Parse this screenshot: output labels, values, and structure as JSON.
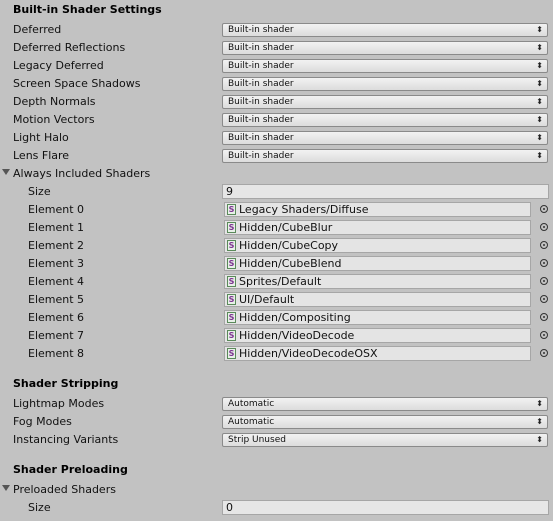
{
  "builtin": {
    "header": "Built-in Shader Settings",
    "rows": [
      {
        "label": "Deferred",
        "value": "Built-in shader"
      },
      {
        "label": "Deferred Reflections",
        "value": "Built-in shader"
      },
      {
        "label": "Legacy Deferred",
        "value": "Built-in shader"
      },
      {
        "label": "Screen Space Shadows",
        "value": "Built-in shader"
      },
      {
        "label": "Depth Normals",
        "value": "Built-in shader"
      },
      {
        "label": "Motion Vectors",
        "value": "Built-in shader"
      },
      {
        "label": "Light Halo",
        "value": "Built-in shader"
      },
      {
        "label": "Lens Flare",
        "value": "Built-in shader"
      }
    ]
  },
  "always_included": {
    "label": "Always Included Shaders",
    "size_label": "Size",
    "size_value": "9",
    "elements": [
      {
        "label": "Element 0",
        "value": "Legacy Shaders/Diffuse"
      },
      {
        "label": "Element 1",
        "value": "Hidden/CubeBlur"
      },
      {
        "label": "Element 2",
        "value": "Hidden/CubeCopy"
      },
      {
        "label": "Element 3",
        "value": "Hidden/CubeBlend"
      },
      {
        "label": "Element 4",
        "value": "Sprites/Default"
      },
      {
        "label": "Element 5",
        "value": "UI/Default"
      },
      {
        "label": "Element 6",
        "value": "Hidden/Compositing"
      },
      {
        "label": "Element 7",
        "value": "Hidden/VideoDecode"
      },
      {
        "label": "Element 8",
        "value": "Hidden/VideoDecodeOSX"
      }
    ],
    "icon_letter": "S"
  },
  "stripping": {
    "header": "Shader Stripping",
    "rows": [
      {
        "label": "Lightmap Modes",
        "value": "Automatic"
      },
      {
        "label": "Fog Modes",
        "value": "Automatic"
      },
      {
        "label": "Instancing Variants",
        "value": "Strip Unused"
      }
    ]
  },
  "preloading": {
    "header": "Shader Preloading",
    "label": "Preloaded Shaders",
    "size_label": "Size",
    "size_value": "0"
  },
  "icons": {
    "dropdown_arrow": "up-down-arrow-icon",
    "object_picker": "object-picker-icon",
    "foldout": "foldout-expanded-icon",
    "shader_asset": "shader-asset-icon"
  }
}
